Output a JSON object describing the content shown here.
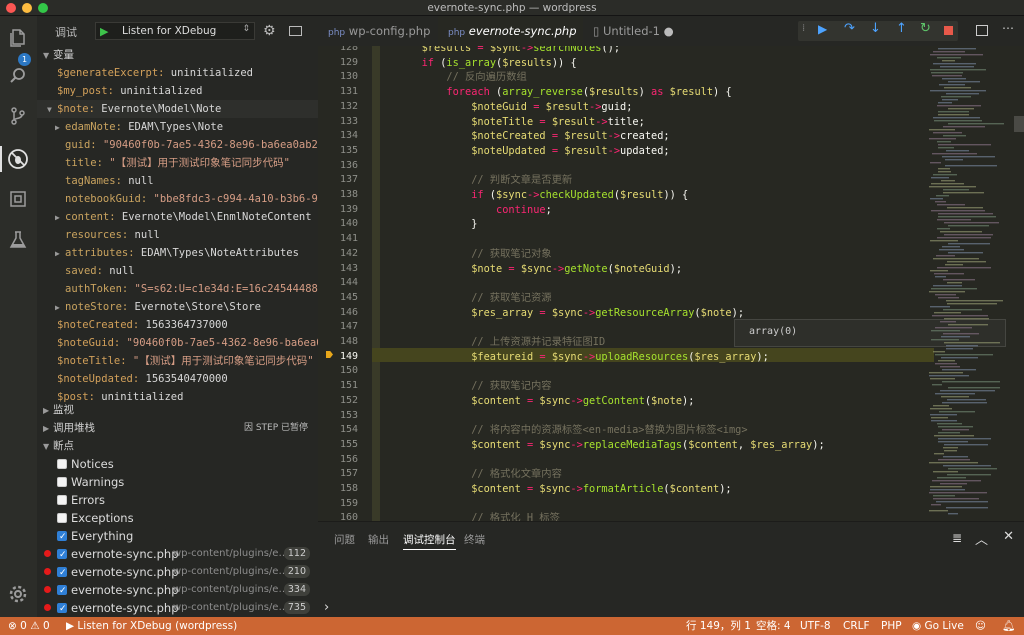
{
  "window": {
    "title": "evernote-sync.php — wordpress"
  },
  "sidebar": {
    "debug_label": "调试",
    "config_select": "Listen for XDebug",
    "variables_header": "变量",
    "variables": [
      {
        "name": "$generateExcerpt:",
        "value": "uninitialized",
        "kind": "plain"
      },
      {
        "name": "$my_post:",
        "value": "uninitialized",
        "kind": "plain"
      },
      {
        "name": "$note:",
        "value": "Evernote\\Model\\Note",
        "kind": "plain"
      },
      {
        "name": "edamNote:",
        "value": "EDAM\\Types\\Note",
        "kind": "plain"
      },
      {
        "name": "guid:",
        "value": "\"90460f0b-7ae5-4362-8e96-ba6ea0ab228f\"",
        "kind": "string"
      },
      {
        "name": "title:",
        "value": "\"【测试】用于测试印象笔记同步代码\"",
        "kind": "string"
      },
      {
        "name": "tagNames:",
        "value": "null",
        "kind": "plain"
      },
      {
        "name": "notebookGuid:",
        "value": "\"bbe8fdc3-c994-4a10-b3b6-9fb0…",
        "kind": "string"
      },
      {
        "name": "content:",
        "value": "Evernote\\Model\\EnmlNoteContent",
        "kind": "plain"
      },
      {
        "name": "resources:",
        "value": "null",
        "kind": "plain"
      },
      {
        "name": "attributes:",
        "value": "EDAM\\Types\\NoteAttributes",
        "kind": "plain"
      },
      {
        "name": "saved:",
        "value": "null",
        "kind": "plain"
      },
      {
        "name": "authToken:",
        "value": "\"S=s62:U=c1e34d:E=16c24544488:C=…",
        "kind": "string"
      },
      {
        "name": "noteStore:",
        "value": "Evernote\\Store\\Store",
        "kind": "plain"
      },
      {
        "name": "$noteCreated:",
        "value": "1563364737000",
        "kind": "plain"
      },
      {
        "name": "$noteGuid:",
        "value": "\"90460f0b-7ae5-4362-8e96-ba6ea0ab…",
        "kind": "string"
      },
      {
        "name": "$noteTitle:",
        "value": "\"【测试】用于测试印象笔记同步代码\"",
        "kind": "string"
      },
      {
        "name": "$noteUpdated:",
        "value": "1563540470000",
        "kind": "plain"
      },
      {
        "name": "$post:",
        "value": "uninitialized",
        "kind": "plain"
      }
    ],
    "watch_header": "监视",
    "callstack_header": "调用堆栈",
    "callstack_status": "因 STEP 已暂停",
    "breakpoints_header": "断点",
    "breakpoint_filters": [
      {
        "label": "Notices",
        "checked": false
      },
      {
        "label": "Warnings",
        "checked": false
      },
      {
        "label": "Errors",
        "checked": false
      },
      {
        "label": "Exceptions",
        "checked": false
      },
      {
        "label": "Everything",
        "checked": true
      }
    ],
    "breakpoints": [
      {
        "file": "evernote-sync.php",
        "path": "wp-content/plugins/e…",
        "line": "112"
      },
      {
        "file": "evernote-sync.php",
        "path": "wp-content/plugins/e…",
        "line": "210"
      },
      {
        "file": "evernote-sync.php",
        "path": "wp-content/plugins/e…",
        "line": "334"
      },
      {
        "file": "evernote-sync.php",
        "path": "wp-content/plugins/e…",
        "line": "735"
      }
    ]
  },
  "tabs": [
    {
      "label": "wp-config.php"
    },
    {
      "label": "evernote-sync.php"
    },
    {
      "label": "Untitled-1"
    }
  ],
  "editor": {
    "hover": "array(0)",
    "lines": [
      {
        "n": "128",
        "t": "        $results = $sync->searchNotes();"
      },
      {
        "n": "129",
        "t": "        if (is_array($results)) {"
      },
      {
        "n": "130",
        "t": "            // 反向遍历数组"
      },
      {
        "n": "131",
        "t": "            foreach (array_reverse($results) as $result) {"
      },
      {
        "n": "132",
        "t": "                $noteGuid = $result->guid;"
      },
      {
        "n": "133",
        "t": "                $noteTitle = $result->title;"
      },
      {
        "n": "134",
        "t": "                $noteCreated = $result->created;"
      },
      {
        "n": "135",
        "t": "                $noteUpdated = $result->updated;"
      },
      {
        "n": "136",
        "t": ""
      },
      {
        "n": "137",
        "t": "                // 判断文章是否更新"
      },
      {
        "n": "138",
        "t": "                if ($sync->checkUpdated($result)) {"
      },
      {
        "n": "139",
        "t": "                    continue;"
      },
      {
        "n": "140",
        "t": "                }"
      },
      {
        "n": "141",
        "t": ""
      },
      {
        "n": "142",
        "t": "                // 获取笔记对象"
      },
      {
        "n": "143",
        "t": "                $note = $sync->getNote($noteGuid);"
      },
      {
        "n": "144",
        "t": ""
      },
      {
        "n": "145",
        "t": "                // 获取笔记资源"
      },
      {
        "n": "146",
        "t": "                $res_array = $sync->getResourceArray($note);"
      },
      {
        "n": "147",
        "t": ""
      },
      {
        "n": "148",
        "t": "                // 上传资源并记录特征图ID"
      },
      {
        "n": "149",
        "t": "                $featureid = $sync->uploadResources($res_array);"
      },
      {
        "n": "150",
        "t": ""
      },
      {
        "n": "151",
        "t": "                // 获取笔记内容"
      },
      {
        "n": "152",
        "t": "                $content = $sync->getContent($note);"
      },
      {
        "n": "153",
        "t": ""
      },
      {
        "n": "154",
        "t": "                // 将内容中的资源标签<en-media>替换为图片标签<img>"
      },
      {
        "n": "155",
        "t": "                $content = $sync->replaceMediaTags($content, $res_array);"
      },
      {
        "n": "156",
        "t": ""
      },
      {
        "n": "157",
        "t": "                // 格式化文章内容"
      },
      {
        "n": "158",
        "t": "                $content = $sync->formatArticle($content);"
      },
      {
        "n": "159",
        "t": ""
      },
      {
        "n": "160",
        "t": "                // 格式化 H 标签"
      }
    ]
  },
  "panel": {
    "tabs": [
      "问题",
      "输出",
      "调试控制台",
      "终端"
    ],
    "prompt": "›"
  },
  "status": {
    "errors": "0",
    "warnings": "0",
    "debug": "Listen for XDebug (wordpress)",
    "position": "行 149，列 1",
    "spaces": "空格: 4",
    "encoding": "UTF-8",
    "eol": "CRLF",
    "lang": "PHP",
    "golive": "Go Live"
  }
}
